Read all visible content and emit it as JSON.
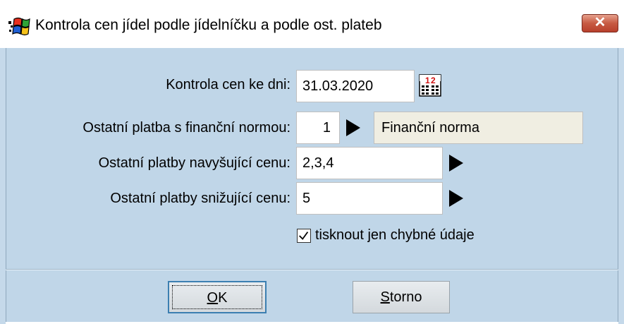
{
  "window": {
    "title": "Kontrola cen jídel  podle jídelníčku a podle ost. plateb",
    "close_glyph": "✕"
  },
  "form": {
    "date_label": "Kontrola cen ke dni:",
    "date_value": "31.03.2020",
    "norm_label": "Ostatní platba s finanční normou:",
    "norm_value": "1",
    "norm_name": "Finanční norma",
    "increase_label": "Ostatní platby navyšující cenu:",
    "increase_value": "2,3,4",
    "decrease_label": "Ostatní platby snižující cenu:",
    "decrease_value": "5",
    "only_errors_label": "tisknout jen chybné údaje",
    "only_errors_checked": true
  },
  "buttons": {
    "ok_mnemonic": "O",
    "ok_rest": "K",
    "cancel_mnemonic": "S",
    "cancel_rest": "torno"
  },
  "colors": {
    "dialog_bg": "#c0d6e8",
    "close_button": "#c75a43",
    "readonly_field": "#f0eee2"
  },
  "icons": {
    "app": "windows-flag-icon",
    "calendar": "calendar-icon",
    "arrow": "play-arrow-icon",
    "check": "checkmark-icon"
  }
}
